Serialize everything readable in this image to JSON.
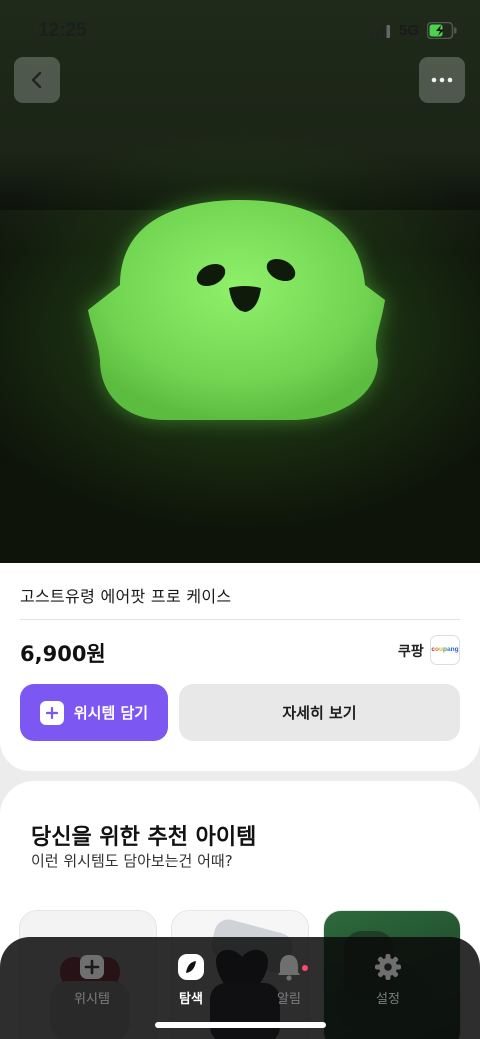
{
  "status_bar": {
    "time": "12:25",
    "network": "5G",
    "icons": [
      "signal-icon",
      "battery-charging-icon"
    ]
  },
  "top_nav": {
    "icons": [
      "chevron-left-icon",
      "more-horizontal-icon"
    ]
  },
  "product": {
    "title": "고스트유령 에어팟 프로 케이스",
    "price": "6,900원",
    "store": "쿠팡",
    "store_logo_text": "coupang",
    "wish_button_label": "위시템 담기",
    "detail_button_label": "자세히 보기",
    "colors": {
      "accent": "#7d57f2",
      "glow": "#7fe05a"
    }
  },
  "recommendations": {
    "title": "당신을 위한 추천 아이템",
    "subtitle": "이런 위시템도 담아보는건 어때?"
  },
  "tab_bar": {
    "tabs": [
      {
        "label": "위시템",
        "icon": "plus-square-icon",
        "active": false
      },
      {
        "label": "탐색",
        "icon": "compass-icon",
        "active": true
      },
      {
        "label": "알림",
        "icon": "bell-icon",
        "active": false,
        "badge": true
      },
      {
        "label": "설정",
        "icon": "gear-icon",
        "active": false
      }
    ]
  }
}
